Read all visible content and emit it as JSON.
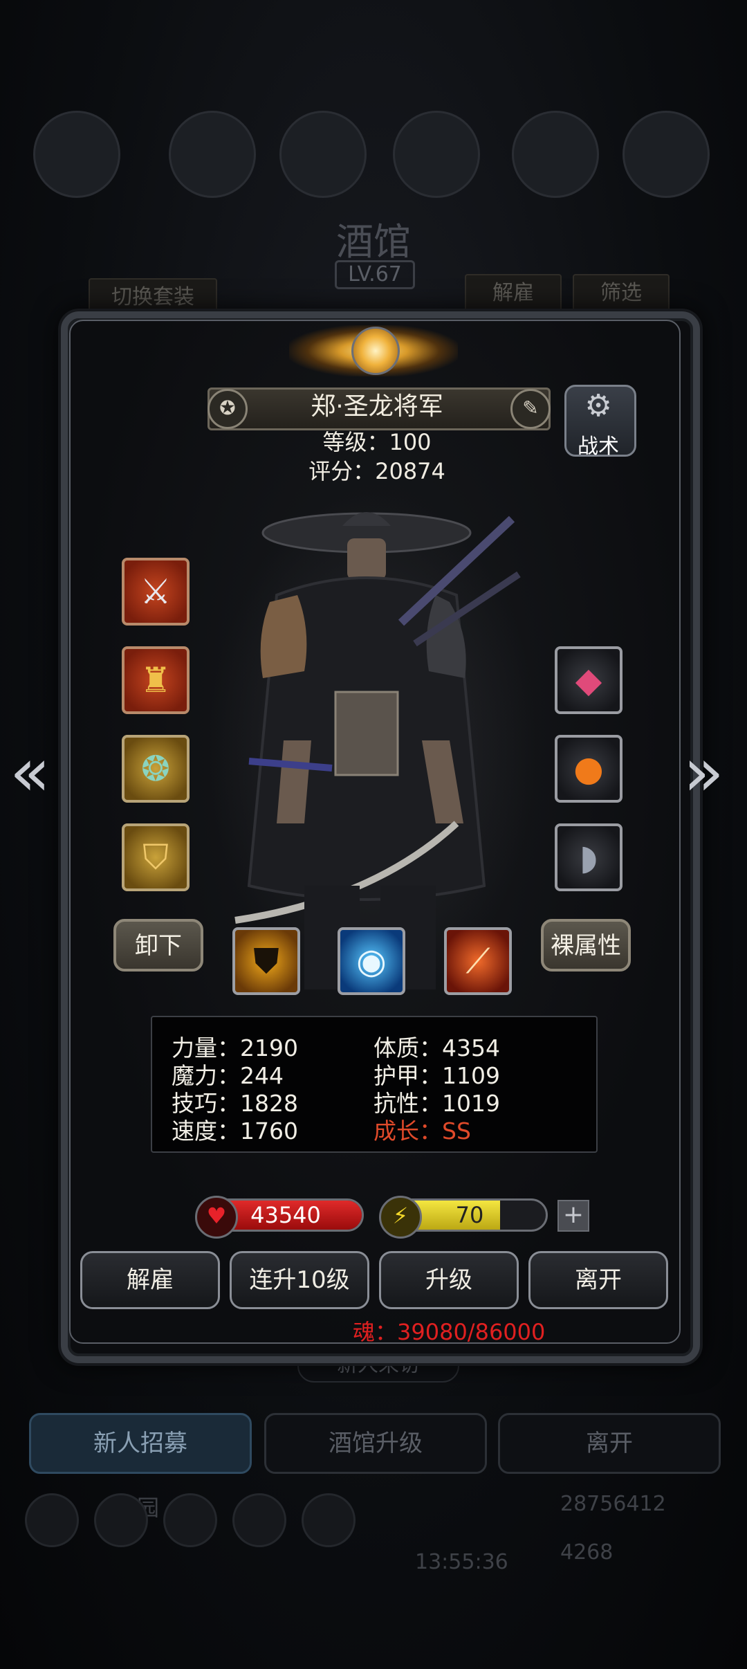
{
  "background": {
    "title": "酒馆",
    "level": "LV.67",
    "switch_outfit": "切换套装",
    "dismiss": "解雇",
    "filter": "筛选",
    "new_visitor": "新人来访",
    "recruit": "新人招募",
    "tavern_upgrade": "酒馆升级",
    "leave": "离开",
    "guild": "墓园",
    "gold": "28756412",
    "gems": "4268",
    "timer": "13:55:36"
  },
  "hero": {
    "name": "郑·圣龙将军",
    "level_label": "等级：100",
    "score_label": "评分：20874",
    "tactics": "战术"
  },
  "equipment": {
    "left": [
      {
        "icon": "sword-icon",
        "rarity": "red"
      },
      {
        "icon": "armor-icon",
        "rarity": "red"
      },
      {
        "icon": "amulet-icon",
        "rarity": "gold"
      },
      {
        "icon": "shield-icon",
        "rarity": "gold"
      }
    ],
    "right": [
      {
        "icon": "gem-icon",
        "rarity": "dark"
      },
      {
        "icon": "pumpkin-icon",
        "rarity": "dark"
      },
      {
        "icon": "bracer-icon",
        "rarity": "dark"
      }
    ]
  },
  "buttons": {
    "unequip": "卸下",
    "base_stats": "裸属性"
  },
  "skills": [
    {
      "icon": "dark-shield-skill-icon"
    },
    {
      "icon": "eye-skill-icon"
    },
    {
      "icon": "slash-skill-icon"
    }
  ],
  "stats": {
    "strength": "力量：2190",
    "magic": "魔力：244",
    "skill": "技巧：1828",
    "speed": "速度：1760",
    "constitution": "体质：4354",
    "armor": "护甲：1109",
    "resistance": "抗性：1019",
    "growth": "成长：SS"
  },
  "hp": {
    "value": "43540",
    "fraction": 1.0
  },
  "energy": {
    "value": "70",
    "fraction": 0.7
  },
  "actions": {
    "dismiss": "解雇",
    "level_up_10": "连升10级",
    "level_up": "升级",
    "leave": "离开"
  },
  "soul": "魂：39080/86000",
  "colors": {
    "growth": "#e04a2a",
    "soul": "#e02020",
    "hp_bar": "#c41414",
    "energy_bar": "#e2d41e"
  }
}
